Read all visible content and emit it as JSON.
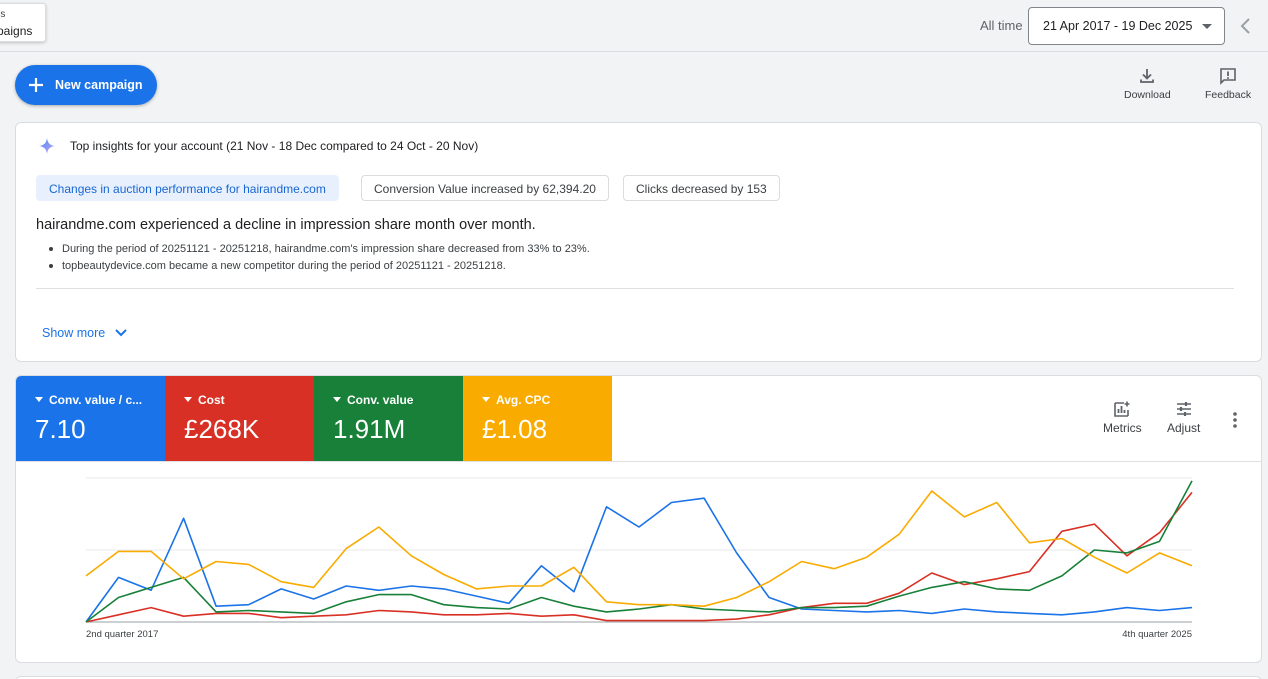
{
  "topbar": {
    "crumb_line1": "s)",
    "crumb_line2": "paigns",
    "all_time_label": "All time",
    "date_range": "21 Apr 2017 - 19 Dec 2025"
  },
  "actions": {
    "new_campaign": "New campaign",
    "download": "Download",
    "feedback": "Feedback"
  },
  "insights": {
    "title": "Top insights for your account (21 Nov - 18 Dec compared to 24 Oct - 20 Nov)",
    "chips": [
      "Changes in auction performance for hairandme.com",
      "Conversion Value increased by 62,394.20",
      "Clicks decreased by 153"
    ],
    "headline": "hairandme.com experienced a decline in impression share month over month.",
    "bullets": [
      "During the period of 20251121 - 20251218, hairandme.com's impression share decreased from 33% to 23%.",
      "topbeautydevice.com became a new competitor during the period of 20251121 - 20251218."
    ],
    "show_more": "Show more"
  },
  "metrics": [
    {
      "name": "Conv. value / c...",
      "value": "7.10",
      "color": "#1a73e8"
    },
    {
      "name": "Cost",
      "value": "£268K",
      "color": "#d93025"
    },
    {
      "name": "Conv. value",
      "value": "1.91M",
      "color": "#188038"
    },
    {
      "name": "Avg. CPC",
      "value": "£1.08",
      "color": "#f9ab00"
    }
  ],
  "perf_tools": {
    "metrics": "Metrics",
    "adjust": "Adjust"
  },
  "chart_data": {
    "type": "line",
    "x_start_label": "2nd quarter 2017",
    "x_end_label": "4th quarter 2025",
    "ylim": [
      0,
      100
    ],
    "grid": true,
    "series": [
      {
        "color": "#1a73e8",
        "values": [
          0,
          31,
          22,
          72,
          11,
          12,
          23,
          16,
          25,
          22,
          25,
          23,
          18,
          13,
          39,
          21,
          80,
          66,
          83,
          86,
          48,
          17,
          9,
          8,
          7,
          8,
          6,
          9,
          7,
          6,
          5,
          7,
          10,
          8,
          10
        ]
      },
      {
        "color": "#d93025",
        "values": [
          0,
          5,
          10,
          4,
          6,
          6,
          3,
          4,
          5,
          8,
          7,
          5,
          5,
          6,
          4,
          5,
          1,
          1,
          1,
          1,
          2,
          5,
          10,
          13,
          13,
          20,
          34,
          26,
          30,
          35,
          63,
          68,
          46,
          62,
          90
        ]
      },
      {
        "color": "#188038",
        "values": [
          0,
          17,
          24,
          31,
          7,
          8,
          7,
          6,
          14,
          19,
          19,
          12,
          10,
          9,
          17,
          11,
          7,
          9,
          12,
          9,
          8,
          7,
          10,
          10,
          11,
          18,
          24,
          28,
          23,
          22,
          32,
          50,
          48,
          56,
          98
        ]
      },
      {
        "color": "#f9ab00",
        "values": [
          32,
          49,
          49,
          30,
          42,
          40,
          28,
          24,
          51,
          66,
          46,
          33,
          23,
          25,
          25,
          38,
          14,
          12,
          12,
          11,
          17,
          28,
          42,
          37,
          45,
          61,
          91,
          73,
          83,
          55,
          58,
          45,
          34,
          48,
          39
        ]
      }
    ]
  }
}
